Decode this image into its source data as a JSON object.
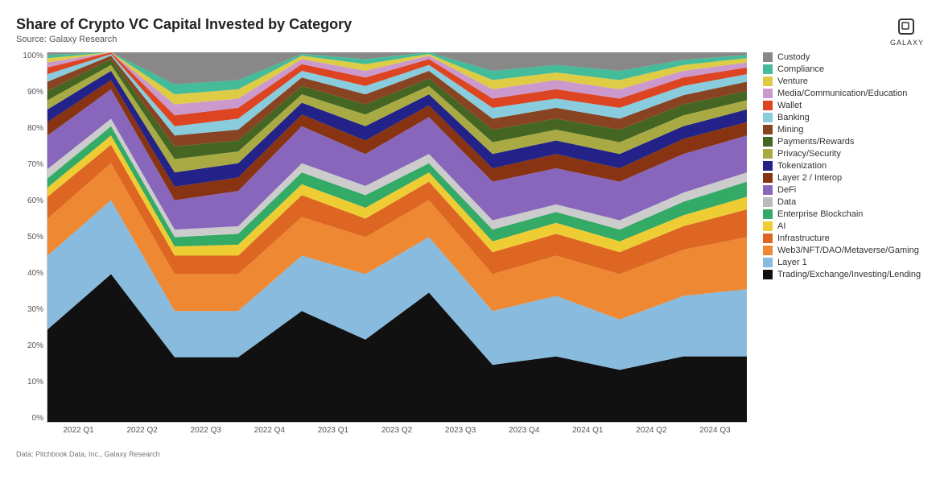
{
  "title": "Share of Crypto VC Capital Invested by Category",
  "source": "Source: Galaxy Research",
  "footer": "Data: Pitchbook Data, Inc., Galaxy Research",
  "yLabels": [
    "0%",
    "10%",
    "20%",
    "30%",
    "40%",
    "50%",
    "60%",
    "70%",
    "80%",
    "90%",
    "100%"
  ],
  "xLabels": [
    "2022 Q1",
    "2022 Q2",
    "2022 Q3",
    "2022 Q4",
    "2023 Q1",
    "2023 Q2",
    "2023 Q3",
    "2023 Q4",
    "2024 Q1",
    "2024 Q2",
    "2024 Q3"
  ],
  "logo": "galaxy",
  "legend": [
    {
      "label": "Custody",
      "color": "#888888"
    },
    {
      "label": "Compliance",
      "color": "#44bb99"
    },
    {
      "label": "Venture",
      "color": "#ddcc44"
    },
    {
      "label": "Media/Communication/Education",
      "color": "#cc99cc"
    },
    {
      "label": "Wallet",
      "color": "#dd4422"
    },
    {
      "label": "Banking",
      "color": "#88ccdd"
    },
    {
      "label": "Mining",
      "color": "#884422"
    },
    {
      "label": "Payments/Rewards",
      "color": "#446622"
    },
    {
      "label": "Privacy/Security",
      "color": "#aaaa44"
    },
    {
      "label": "Tokenization",
      "color": "#222288"
    },
    {
      "label": "Layer 2 / Interop",
      "color": "#883311"
    },
    {
      "label": "DeFi",
      "color": "#8866bb"
    },
    {
      "label": "Data",
      "color": "#bbbbbb"
    },
    {
      "label": "Enterprise Blockchain",
      "color": "#33aa66"
    },
    {
      "label": "AI",
      "color": "#eecc33"
    },
    {
      "label": "Infrastructure",
      "color": "#dd6622"
    },
    {
      "label": "Web3/NFT/DAO/Metaverse/Gaming",
      "color": "#ee8833"
    },
    {
      "label": "Layer 1",
      "color": "#88bbdd"
    },
    {
      "label": "Trading/Exchange/Investing/Lending",
      "color": "#111111"
    }
  ]
}
